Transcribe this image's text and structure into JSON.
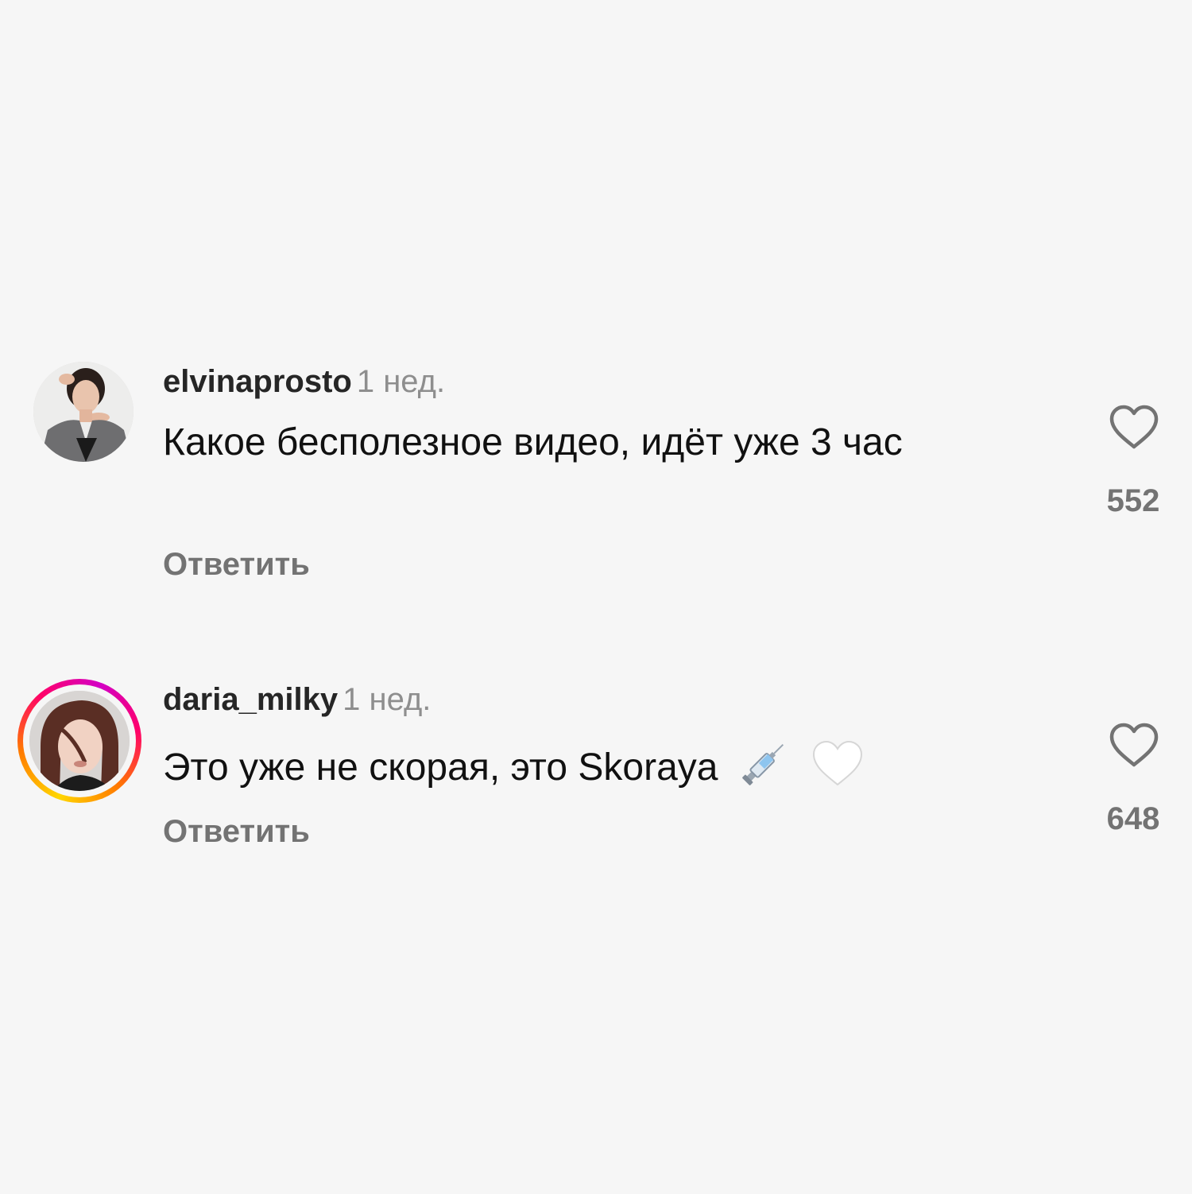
{
  "comments": [
    {
      "username": "elvinaprosto",
      "time": "1 нед.",
      "text": "Какое бесполезное видео, идёт уже 3 час",
      "reply_label": "Ответить",
      "likes": "552",
      "has_story": false,
      "like_icon": "heart-outline-icon"
    },
    {
      "username": "daria_milky",
      "time": "1 нед.",
      "text": "Это уже не скорая, это Skoraya",
      "emojis": [
        "syringe-emoji",
        "white-heart-emoji"
      ],
      "reply_label": "Ответить",
      "likes": "648",
      "has_story": true,
      "like_icon": "heart-outline-icon"
    }
  ],
  "colors": {
    "background": "#f6f6f6",
    "username": "#262626",
    "secondary": "#8e8e8e",
    "muted_bold": "#737373"
  }
}
